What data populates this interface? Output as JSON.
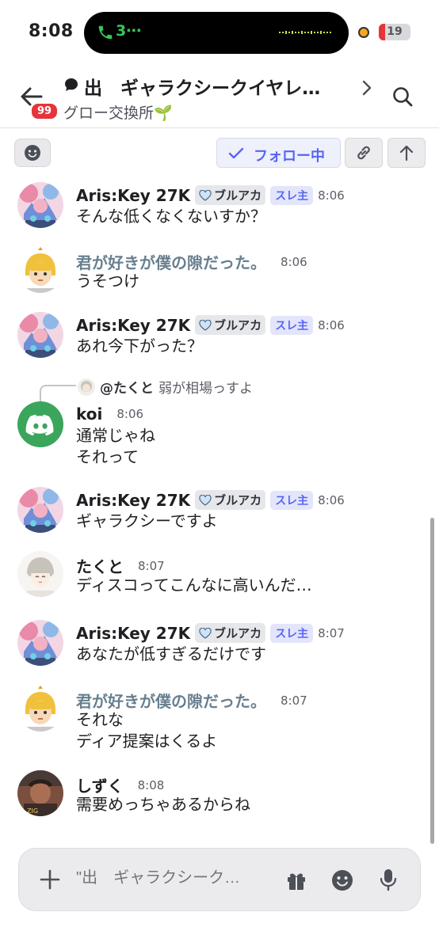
{
  "status_bar": {
    "time": "8:08",
    "call_indicator": "3⋯",
    "battery_level": "19",
    "battery_fraction": 0.19
  },
  "header": {
    "thread_title": "出　ギャラクシークイヤレ…",
    "channel_name": "グロー交換所🌱",
    "unread_count": "99",
    "thread_icon": "speech-bubble-icon",
    "back_icon": "arrow-left-icon",
    "search_icon": "search-icon"
  },
  "actions": {
    "follow_label": "フォロー中",
    "accent": "#5865f2"
  },
  "messages": [
    {
      "author": "Aris:Key 27K",
      "tag": "ブルアカ",
      "op_badge": "スレ主",
      "time": "8:06",
      "lines": [
        "そんな低くなくないすか？"
      ]
    },
    {
      "author": "君が好きが僕の隙だった。",
      "time": "8:06",
      "lines": [
        "うそつけ"
      ]
    },
    {
      "author": "Aris:Key 27K",
      "tag": "ブルアカ",
      "op_badge": "スレ主",
      "time": "8:06",
      "lines": [
        "あれ今下がった？"
      ]
    },
    {
      "author": "koi",
      "time": "8:06",
      "reply_to_user": "@たくと",
      "reply_to_text": "弱が相場っすよ",
      "lines": [
        "通常じゃね",
        "それって"
      ]
    },
    {
      "author": "Aris:Key 27K",
      "tag": "ブルアカ",
      "op_badge": "スレ主",
      "time": "8:06",
      "lines": [
        "ギャラクシーですよ"
      ]
    },
    {
      "author": "たくと",
      "time": "8:07",
      "lines": [
        "ディスコってこんなに高いんだ…"
      ]
    },
    {
      "author": "Aris:Key 27K",
      "tag": "ブルアカ",
      "op_badge": "スレ主",
      "time": "8:07",
      "lines": [
        "あなたが低すぎるだけです"
      ]
    },
    {
      "author": "君が好きが僕の隙だった。",
      "time": "8:07",
      "lines": [
        "それな",
        "ディア提案はくるよ"
      ]
    },
    {
      "author": "しずく",
      "time": "8:08",
      "lines": [
        "需要めっちゃあるからね"
      ]
    }
  ],
  "composer": {
    "placeholder": "\"出　ギャラクシーク…"
  }
}
